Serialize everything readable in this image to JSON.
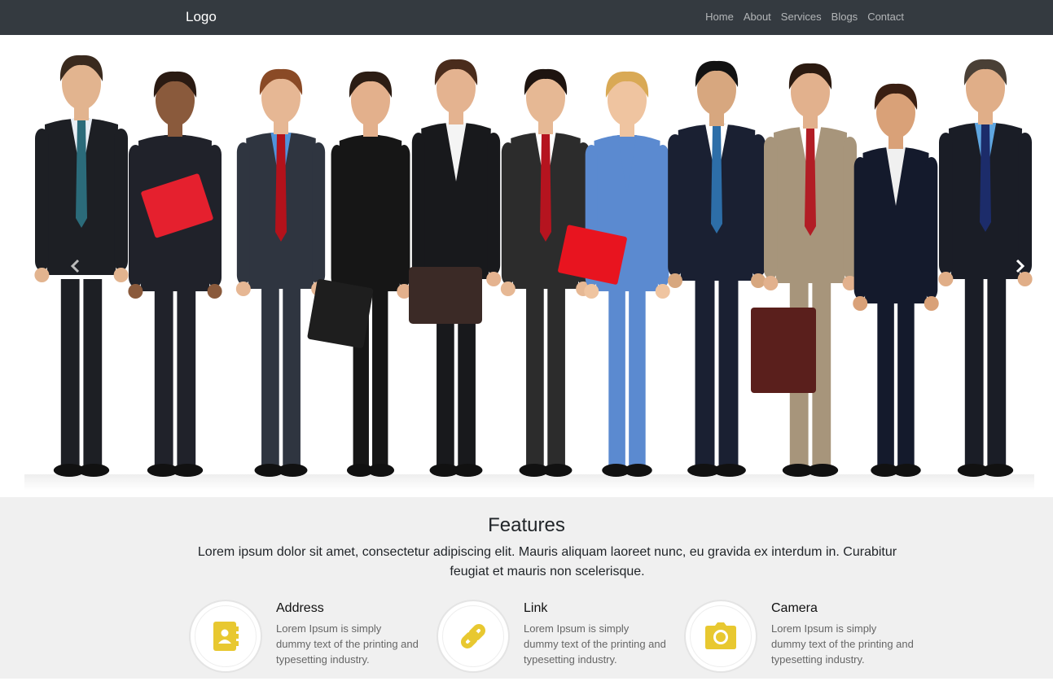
{
  "header": {
    "logo": "Logo",
    "nav": [
      "Home",
      "About",
      "Services",
      "Blogs",
      "Contact"
    ]
  },
  "carousel": {
    "prev_icon": "chevron-left-icon",
    "next_icon": "chevron-right-icon"
  },
  "features": {
    "title": "Features",
    "lead": "Lorem ipsum dolor sit amet, consectetur adipiscing elit. Mauris aliquam laoreet nunc, eu gravida ex interdum in. Curabitur feugiat et mauris non scelerisque.",
    "items": [
      {
        "title": "Address",
        "text": "Lorem Ipsum is simply dummy text of the printing and typesetting industry.",
        "icon": "address-book-icon"
      },
      {
        "title": "Link",
        "text": "Lorem Ipsum is simply dummy text of the printing and typesetting industry.",
        "icon": "link-icon"
      },
      {
        "title": "Camera",
        "text": "Lorem Ipsum is simply dummy text of the printing and typesetting industry.",
        "icon": "camera-icon"
      }
    ]
  },
  "colors": {
    "navbar": "#343a40",
    "features_bg": "#f0f0f0",
    "icon_accent": "#e8c830"
  }
}
